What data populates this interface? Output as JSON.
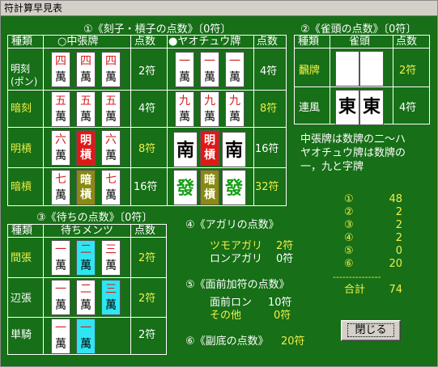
{
  "window": {
    "title": "符計算早見表"
  },
  "mentsu": {
    "heading": "①《刻子・槓子の点数》〔0符〕",
    "col_type": "種類",
    "col_chun": "○中張牌",
    "col_pts1": "点数",
    "col_yao": "●ヤオチュウ牌",
    "col_pts2": "点数",
    "rows": [
      {
        "type": "明刻\n(ポン)",
        "chun_pts": "2符",
        "yao_pts": "4符"
      },
      {
        "type": "暗刻",
        "chun_pts": "4符",
        "yao_pts": "8符"
      },
      {
        "type": "明槓",
        "chun_pts": "8符",
        "yao_pts": "16符"
      },
      {
        "type": "暗槓",
        "chun_pts": "16符",
        "yao_pts": "32符"
      }
    ]
  },
  "jantou": {
    "heading": "②《雀頭の点数》〔0符〕",
    "col_type": "種類",
    "col_tile": "雀頭",
    "col_pts": "点数",
    "rows": [
      {
        "type": "飜牌",
        "pts": "2符"
      },
      {
        "type": "連風",
        "pts": "4符"
      }
    ]
  },
  "note": {
    "line1": "中張牌は数牌の二～ハ",
    "line2": "ヤオチュウ牌は数牌の",
    "line3": "一，九と字牌"
  },
  "machi": {
    "heading": "③《待ちの点数》〔0符〕",
    "col_type": "種類",
    "col_wait": "待ちメンツ",
    "col_pts": "点数",
    "rows": [
      {
        "type": "間張",
        "pts": "2符"
      },
      {
        "type": "辺張",
        "pts": "2符"
      },
      {
        "type": "単騎",
        "pts": "2符"
      }
    ]
  },
  "agari": {
    "heading": "④《アガリの点数》",
    "tsumo": "ツモアガリ",
    "tsumo_pts": "2符",
    "ron": "ロンアガリ",
    "ron_pts": "0符"
  },
  "menzen": {
    "heading": "⑤《面前加符の点数》",
    "ron": "面前ロン",
    "ron_pts": "10符",
    "other": "その他",
    "other_pts": "0符"
  },
  "futei": {
    "heading": "⑥《副底の点数》",
    "pts": "20符"
  },
  "summary": {
    "items": [
      {
        "label": "①",
        "value": "48"
      },
      {
        "label": "②",
        "value": "2"
      },
      {
        "label": "③",
        "value": "2"
      },
      {
        "label": "④",
        "value": "2"
      },
      {
        "label": "⑤",
        "value": "0"
      },
      {
        "label": "⑥",
        "value": "20"
      }
    ],
    "dashes": "---------------",
    "total_label": "合計",
    "total_value": "74"
  },
  "buttons": {
    "close": "閉じる"
  },
  "tiles": {
    "man": "萬"
  },
  "colors": {
    "bg": "#176f17",
    "yellow": "#f0f048",
    "red": "#d42020",
    "cyan": "#2ee6f2",
    "green": "#14a014"
  }
}
